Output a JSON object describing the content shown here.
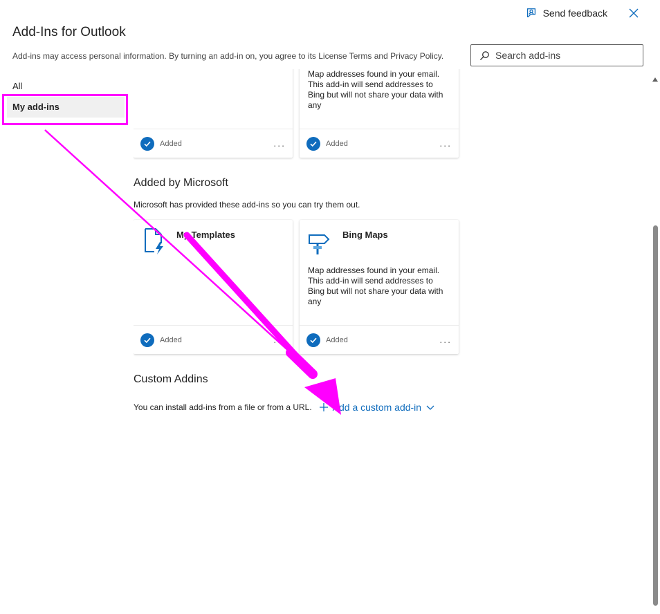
{
  "header": {
    "feedback_label": "Send feedback",
    "title": "Add-Ins for Outlook",
    "subtitle": "Add-ins may access personal information. By turning an add-in on, you agree to its License Terms and Privacy Policy."
  },
  "search": {
    "placeholder": "Search add-ins"
  },
  "nav": {
    "all": "All",
    "my_addins": "My add-ins"
  },
  "top_cards": [
    {
      "desc": "",
      "status": "Added"
    },
    {
      "desc": "Map addresses found in your email. This add-in will send addresses to Bing but will not share your data with any",
      "status": "Added"
    }
  ],
  "microsoft_section": {
    "title": "Added by Microsoft",
    "desc": "Microsoft has provided these add-ins so you can try them out."
  },
  "ms_cards": [
    {
      "name": "My Templates",
      "desc": "",
      "status": "Added",
      "icon": "document-lightning-icon"
    },
    {
      "name": "Bing Maps",
      "desc": "Map addresses found in your email. This add-in will send addresses to Bing but will not share your data with any",
      "status": "Added",
      "icon": "signpost-icon"
    }
  ],
  "custom_section": {
    "title": "Custom Addins",
    "desc": "You can install add-ins from a file or from a URL.",
    "add_label": "Add a custom add-in"
  },
  "colors": {
    "accent": "#0f6cbd",
    "highlight": "#ff00ff"
  },
  "more_glyph": "..."
}
